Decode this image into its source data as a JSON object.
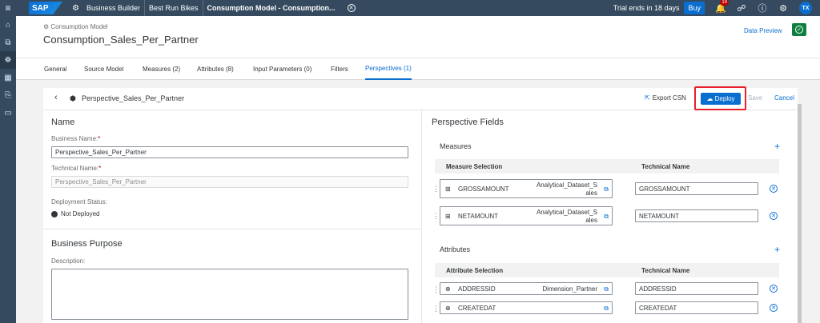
{
  "shell": {
    "logo": "SAP",
    "breadcrumbs": [
      "Business Builder",
      "Best Run Bikes",
      "Consumption Model - Consumption..."
    ],
    "trial": "Trial ends in 18 days",
    "buy": "Buy",
    "notification_count": "19",
    "avatar": "TX"
  },
  "header": {
    "subtitle": "Consumption Model",
    "title": "Consumption_Sales_Per_Partner",
    "data_preview": "Data Preview"
  },
  "tabs": [
    {
      "label": "General"
    },
    {
      "label": "Source Model"
    },
    {
      "label": "Measures (2)"
    },
    {
      "label": "Attributes (8)"
    },
    {
      "label": "Input Parameters (0)"
    },
    {
      "label": "Filters"
    },
    {
      "label": "Perspectives (1)"
    }
  ],
  "toolbar": {
    "title": "Perspective_Sales_Per_Partner",
    "export": "Export CSN",
    "deploy": "Deploy",
    "save": "Save",
    "cancel": "Cancel"
  },
  "name_section": {
    "title": "Name",
    "business_name_label": "Business Name:",
    "business_name_value": "Perspective_Sales_Per_Partner",
    "technical_name_label": "Technical Name:",
    "technical_name_value": "Perspective_Sales_Per_Partner",
    "deployment_label": "Deployment Status:",
    "deployment_value": "Not Deployed",
    "required_marker": "*"
  },
  "purpose_section": {
    "title": "Business Purpose",
    "description_label": "Description:"
  },
  "fields": {
    "title": "Perspective Fields",
    "measures": {
      "title": "Measures",
      "col_selection": "Measure Selection",
      "col_technical": "Technical Name",
      "rows": [
        {
          "name": "GROSSAMOUNT",
          "source_line1": "Analytical_Dataset_S",
          "source_line2": "ales",
          "technical": "GROSSAMOUNT"
        },
        {
          "name": "NETAMOUNT",
          "source_line1": "Analytical_Dataset_S",
          "source_line2": "ales",
          "technical": "NETAMOUNT"
        }
      ]
    },
    "attributes": {
      "title": "Attributes",
      "col_selection": "Attribute Selection",
      "col_technical": "Technical Name",
      "rows": [
        {
          "name": "ADDRESSID",
          "source": "Dimension_Partner",
          "technical": "ADDRESSID"
        },
        {
          "name": "CREATEDAT",
          "source": "",
          "technical": "CREATEDAT"
        }
      ]
    }
  }
}
